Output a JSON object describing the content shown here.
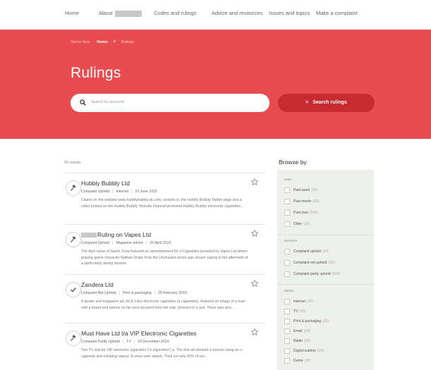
{
  "nav": {
    "items": [
      "Home",
      "About",
      "Codes and rulings",
      "Advice and resources",
      "Issues and topics",
      "Make a complaint"
    ]
  },
  "breadcrumb": {
    "prefix": "You're here",
    "home": "Home",
    "separator": ">",
    "current": "Rulings"
  },
  "page_title": "Rulings",
  "search": {
    "placeholder": "Search by keyword",
    "button_label": "Search rulings",
    "button_arrow": ">"
  },
  "results": {
    "count_label": "55 results",
    "items": [
      {
        "title": "Hubbly Bubbly Ltd",
        "status": "Compaint Upheld",
        "media": "Internet",
        "date": "10 June 2015",
        "description": "Claims on the website www.hubblybubbly.uk.com, content on the Hubbly Bubbly Twitter page and a video posted on the Hubbly Bubbly Youtube channel promoted Hubbly Bubbly electronic cigarettes...",
        "icon": "gavel-icon"
      },
      {
        "title": "Ruling on Vapes Ltd",
        "status": "Compaint Upheld",
        "media": "Magazine advert",
        "date": "29 April 2015",
        "description": "The April issue of Game Zone featured an advertisement for e-Cigarettes provided by Vapes Ltd where popular game character Nathan Drake from the Uncharted series was shown vaping in the aftermath of a particularly daring mission.",
        "icon": "gavel-icon"
      },
      {
        "title": "Zandera Ltd",
        "status": "Compaint Not Upheld",
        "media": "Print & packaging",
        "date": "25 February 2015",
        "description": "A poster and magazine ad, for E-Lites electronic cigarettes (e-cigarettes), featured an image of a man with a beard and tattoos on his neck pictured from the side, dressed in a suit. There was also...",
        "icon": "check-icon"
      },
      {
        "title": "Must Have Ltd t/a VIP Electronic Cigarettes",
        "status": "Compaint Partly Upheld",
        "media": "TV",
        "date": "24 December 2014",
        "description": "Two TV ads for VIP electronic cigarettes (\"e-cigarettes\").a. The first ad showed a woman using an e-cigarette and exhaling vapour. A voice-over stated, \"Find out why 89% of our...",
        "icon": "gavel-icon"
      }
    ]
  },
  "browse": {
    "title": "Browse by",
    "sections": [
      {
        "heading": "Date",
        "options": [
          {
            "label": "Past week",
            "count": "(20)"
          },
          {
            "label": "Past month",
            "count": "(60)"
          },
          {
            "label": "Past year",
            "count": "(600)"
          },
          {
            "label": "Older",
            "count": "(20)"
          }
        ]
      },
      {
        "heading": "Decision",
        "options": [
          {
            "label": "Complaint upheld",
            "count": "(20)"
          },
          {
            "label": "Complaint not upheld",
            "count": "(60)"
          },
          {
            "label": "Complaint partly upheld",
            "count": "(600)"
          }
        ]
      },
      {
        "heading": "Media",
        "options": [
          {
            "label": "Internet",
            "count": "(20)"
          },
          {
            "label": "TV",
            "count": "(20)"
          },
          {
            "label": "Print & packaging",
            "count": "(20)"
          },
          {
            "label": "Email",
            "count": "(20)"
          },
          {
            "label": "Radio",
            "count": "(20)"
          },
          {
            "label": "Digital outdoor",
            "count": "(20)"
          },
          {
            "label": "Game",
            "count": "(20)"
          }
        ]
      }
    ]
  },
  "colors": {
    "hero": "#e84c50",
    "search_button": "#c82a31",
    "browse_panel": "#eef0eb"
  }
}
